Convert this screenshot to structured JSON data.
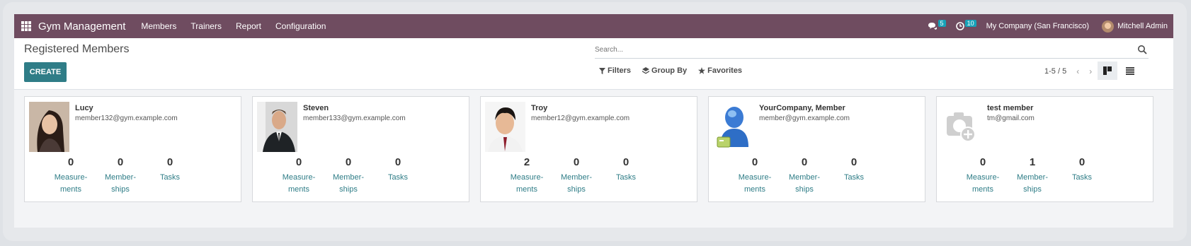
{
  "navbar": {
    "app_name": "Gym Management",
    "menu": [
      "Members",
      "Trainers",
      "Report",
      "Configuration"
    ],
    "messages_count": "5",
    "activities_count": "10",
    "company": "My Company (San Francisco)",
    "user": "Mitchell Admin",
    "accent_color": "#6f4c60"
  },
  "control_panel": {
    "title": "Registered Members",
    "create_label": "CREATE",
    "search_placeholder": "Search...",
    "filters_label": "Filters",
    "groupby_label": "Group By",
    "favorites_label": "Favorites",
    "pager": "1-5 / 5"
  },
  "members": [
    {
      "name": "Lucy",
      "email": "member132@gym.example.com",
      "avatar": "photo-woman",
      "stats": [
        {
          "value": "0",
          "label": "Measure-\nments"
        },
        {
          "value": "0",
          "label": "Member-\nships"
        },
        {
          "value": "0",
          "label": "Tasks"
        }
      ]
    },
    {
      "name": "Steven",
      "email": "member133@gym.example.com",
      "avatar": "photo-man-suit",
      "stats": [
        {
          "value": "0",
          "label": "Measure-\nments"
        },
        {
          "value": "0",
          "label": "Member-\nships"
        },
        {
          "value": "0",
          "label": "Tasks"
        }
      ]
    },
    {
      "name": "Troy",
      "email": "member12@gym.example.com",
      "avatar": "photo-young-man",
      "stats": [
        {
          "value": "2",
          "label": "Measure-\nments"
        },
        {
          "value": "0",
          "label": "Member-\nships"
        },
        {
          "value": "0",
          "label": "Tasks"
        }
      ]
    },
    {
      "name": "YourCompany, Member",
      "email": "member@gym.example.com",
      "avatar": "company-user-icon",
      "stats": [
        {
          "value": "0",
          "label": "Measure-\nments"
        },
        {
          "value": "0",
          "label": "Member-\nships"
        },
        {
          "value": "0",
          "label": "Tasks"
        }
      ]
    },
    {
      "name": "test member",
      "email": "tm@gmail.com",
      "avatar": "placeholder-camera-icon",
      "stats": [
        {
          "value": "0",
          "label": "Measure-\nments"
        },
        {
          "value": "1",
          "label": "Member-\nships"
        },
        {
          "value": "0",
          "label": "Tasks"
        }
      ]
    }
  ]
}
